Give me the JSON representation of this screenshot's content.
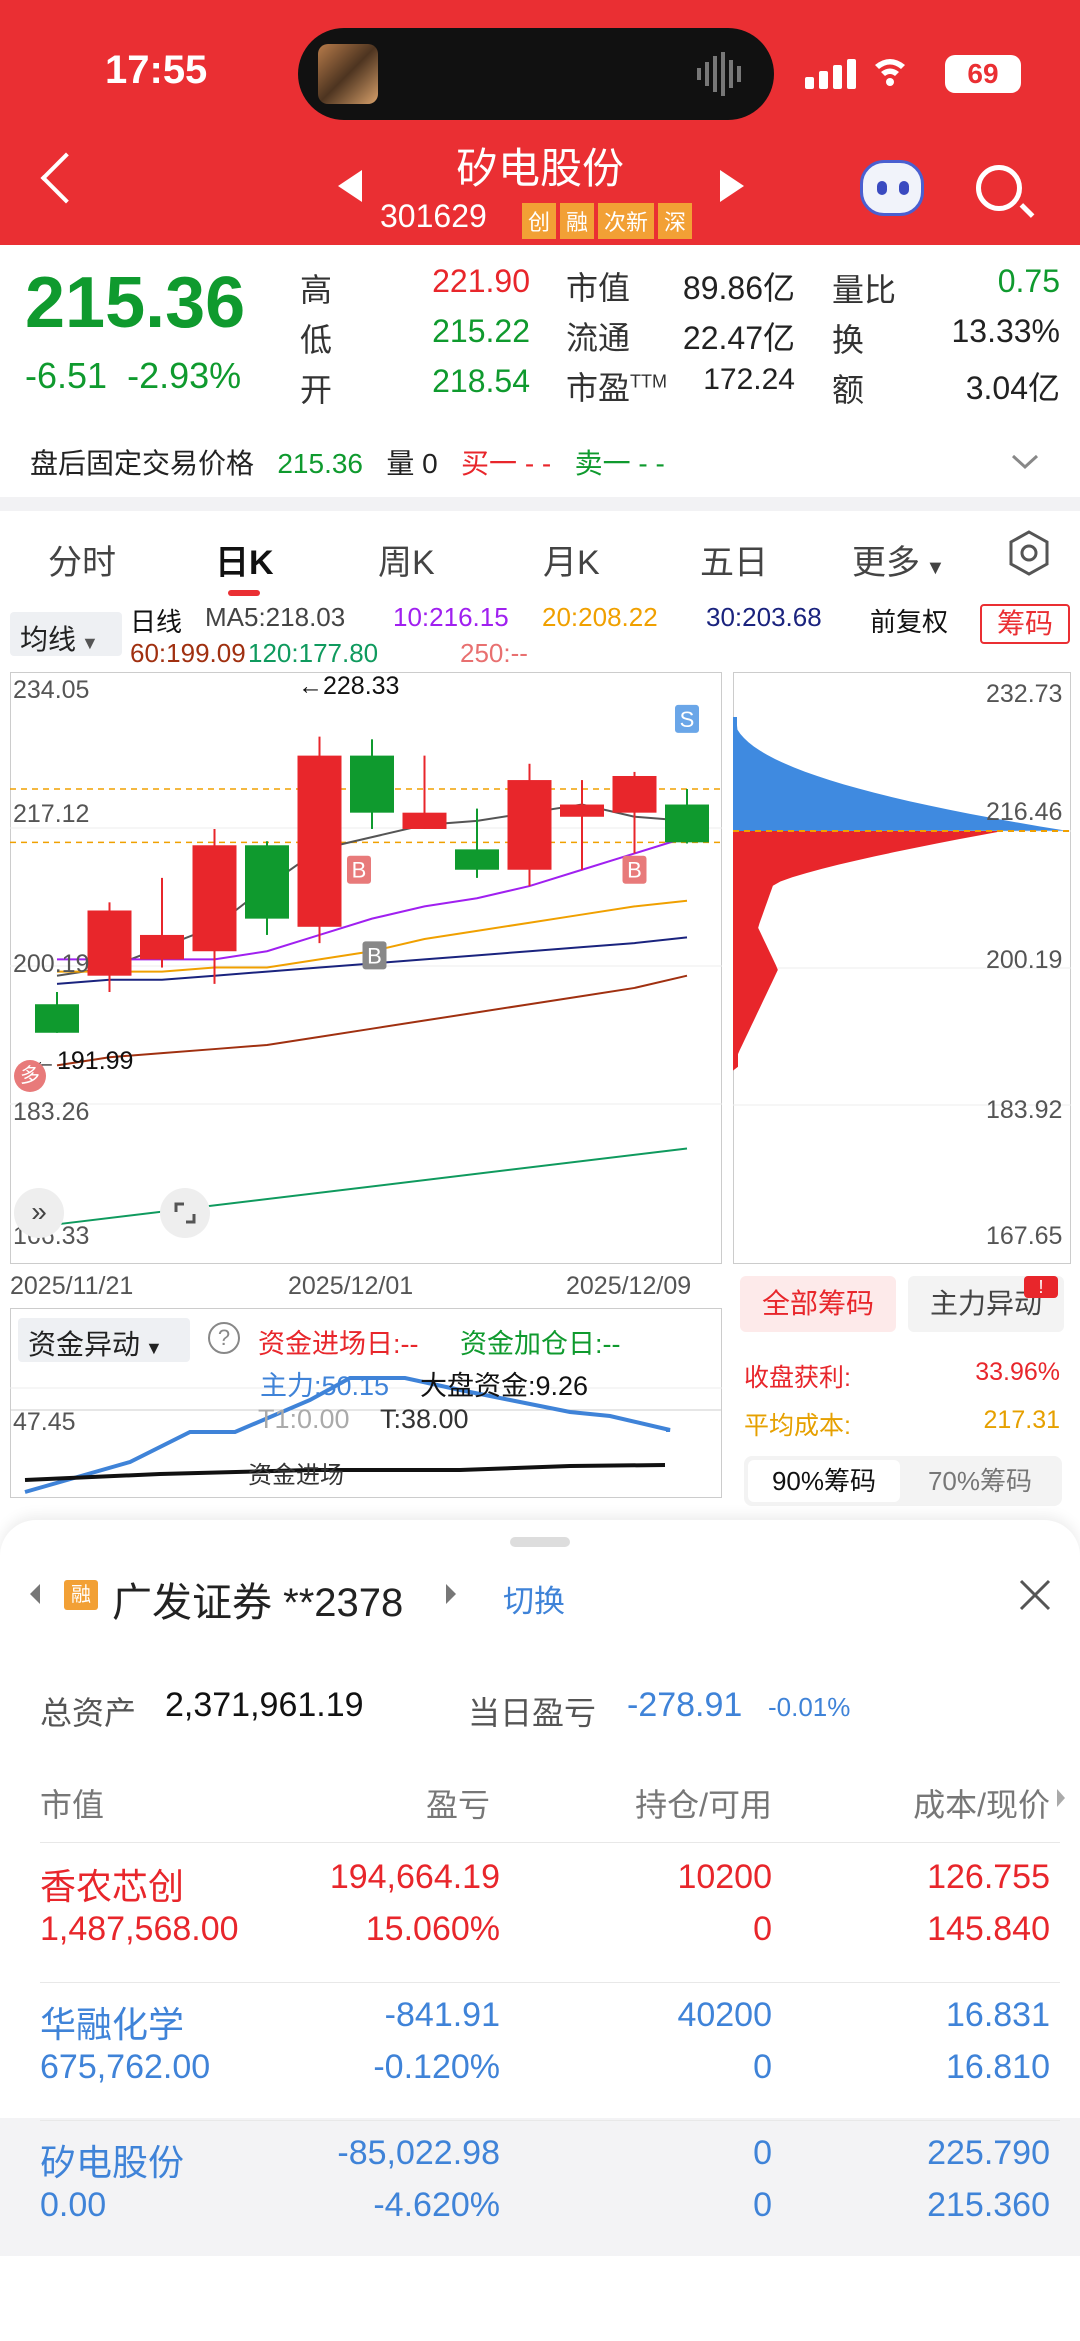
{
  "status": {
    "time": "17:55",
    "battery": "69"
  },
  "header": {
    "name": "矽电股份",
    "code": "301629",
    "tags": [
      "创",
      "融",
      "次新",
      "深"
    ]
  },
  "quote": {
    "price": "215.36",
    "change": "-6.51",
    "change_pct": "-2.93%",
    "high_label": "高",
    "high": "221.90",
    "low_label": "低",
    "low": "215.22",
    "open_label": "开",
    "open": "218.54",
    "mcap_label": "市值",
    "mcap": "89.86亿",
    "float_label": "流通",
    "float": "22.47亿",
    "pe_label": "市盈",
    "pe_sup": "TTM",
    "pe": "172.24",
    "vol_ratio_label": "量比",
    "vol_ratio": "0.75",
    "turnover_label": "换",
    "turnover": "13.33%",
    "amount_label": "额",
    "amount": "3.04亿"
  },
  "after_hours": {
    "label": "盘后固定交易价格",
    "price": "215.36",
    "vol": "量 0",
    "buy": "买一 - -",
    "sell": "卖一 - -"
  },
  "tabs": [
    "分时",
    "日K",
    "周K",
    "月K",
    "五日",
    "更多"
  ],
  "ma": {
    "select": "均线",
    "period": "日线",
    "ma5": "MA5:218.03",
    "ma10": "10:216.15",
    "ma20": "20:208.22",
    "ma30": "30:203.68",
    "fuquan": "前复权",
    "chips": "筹码",
    "ma60": "60:199.09",
    "ma120": "120:177.80",
    "ma250": "250:--"
  },
  "colors": {
    "up": "#e8262b",
    "down": "#0f9a2e",
    "ma5": "#555555",
    "ma10": "#a020f0",
    "ma20": "#f0a000",
    "ma30": "#1a237e",
    "ma60": "#a03010",
    "ma120": "#0f9a5e"
  },
  "chart_data": [
    {
      "type": "candlestick",
      "title": "日K",
      "y_ticks": [
        "234.05",
        "217.12",
        "200.19",
        "183.26",
        "166.33"
      ],
      "ylim": [
        166.33,
        234.05
      ],
      "x_ticks": [
        "2025/11/21",
        "2025/12/01",
        "2025/12/09"
      ],
      "annotations": {
        "high_marker": "←228.33",
        "low_marker": "←191.99",
        "buy_marks": [
          "B",
          "B",
          "B"
        ],
        "sell_mark": "S",
        "duo": "多"
      },
      "candles": [
        {
          "o": 195.5,
          "c": 192.0,
          "h": 197.0,
          "l": 191.99
        },
        {
          "o": 199.0,
          "c": 207.0,
          "h": 208.0,
          "l": 197.0
        },
        {
          "o": 201.0,
          "c": 204.0,
          "h": 211.0,
          "l": 200.0
        },
        {
          "o": 202.0,
          "c": 215.0,
          "h": 217.0,
          "l": 198.0
        },
        {
          "o": 215.0,
          "c": 206.0,
          "h": 215.5,
          "l": 204.0
        },
        {
          "o": 205.0,
          "c": 226.0,
          "h": 228.33,
          "l": 203.0
        },
        {
          "o": 226.0,
          "c": 219.0,
          "h": 228.0,
          "l": 217.0
        },
        {
          "o": 217.0,
          "c": 219.0,
          "h": 226.0,
          "l": 217.0
        },
        {
          "o": 214.5,
          "c": 212.0,
          "h": 219.5,
          "l": 211.0
        },
        {
          "o": 212.0,
          "c": 223.0,
          "h": 225.0,
          "l": 210.0
        },
        {
          "o": 218.5,
          "c": 220.0,
          "h": 223.0,
          "l": 212.0
        },
        {
          "o": 219.0,
          "c": 223.5,
          "h": 224.0,
          "l": 214.0
        },
        {
          "o": 220.0,
          "c": 215.36,
          "h": 221.9,
          "l": 215.22
        }
      ]
    },
    {
      "type": "bar",
      "title": "筹码分布",
      "y_ticks": [
        "232.73",
        "216.46",
        "200.19",
        "183.92",
        "167.65"
      ],
      "ylim": [
        167.65,
        232.73
      ],
      "current_price_line": 216.46
    },
    {
      "type": "line",
      "title": "资金异动",
      "y_ticks": [
        "47.45"
      ],
      "series": [
        {
          "name": "主力"
        },
        {
          "name": "大盘资金"
        }
      ]
    }
  ],
  "chips_panel": {
    "tab_all": "全部筹码",
    "tab_main": "主力异动",
    "profit_label": "收盘获利:",
    "profit": "33.96%",
    "avg_label": "平均成本:",
    "avg": "217.31",
    "btn90": "90%筹码",
    "btn70": "70%筹码"
  },
  "fund": {
    "select": "资金异动",
    "in_day": "资金进场日:--",
    "add_day": "资金加仓日:--",
    "main": "主力:50.15",
    "market": "大盘资金:9.26",
    "t1": "T1:0.00",
    "t": "T:38.00",
    "label": "资金进场"
  },
  "account": {
    "broker_tag": "融",
    "broker": "广发证券",
    "account": "**2378",
    "switch": "切换",
    "total_label": "总资产",
    "total": "2,371,961.19",
    "pnl_label": "当日盈亏",
    "pnl": "-278.91",
    "pnl_pct": "-0.01%",
    "cols": [
      "市值",
      "盈亏",
      "持仓/可用",
      "成本/现价"
    ],
    "rows": [
      {
        "name": "香农芯创",
        "mv": "1,487,568.00",
        "pnl": "194,664.19",
        "pnl_pct": "15.060%",
        "hold": "10200",
        "avail": "0",
        "cost": "126.755",
        "price": "145.840"
      },
      {
        "name": "华融化学",
        "mv": "675,762.00",
        "pnl": "-841.91",
        "pnl_pct": "-0.120%",
        "hold": "40200",
        "avail": "0",
        "cost": "16.831",
        "price": "16.810"
      },
      {
        "name": "矽电股份",
        "mv": "0.00",
        "pnl": "-85,022.98",
        "pnl_pct": "-4.620%",
        "hold": "0",
        "avail": "0",
        "cost": "225.790",
        "price": "215.360"
      }
    ]
  }
}
